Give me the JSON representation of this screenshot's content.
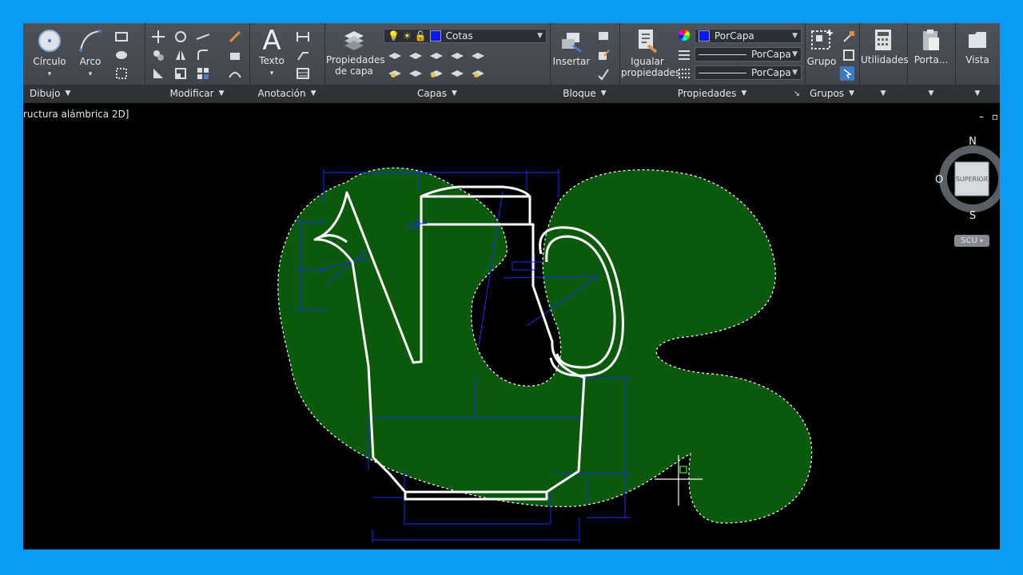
{
  "ribbon": {
    "dibujo": {
      "panel_label": "Dibujo",
      "circle": "Círculo",
      "arc": "Arco"
    },
    "modificar": {
      "panel_label": "Modificar"
    },
    "anotacion": {
      "panel_label": "Anotación",
      "text": "Texto"
    },
    "capas": {
      "panel_label": "Capas",
      "layer_props_1": "Propiedades",
      "layer_props_2": "de capa",
      "current_layer": "Cotas",
      "layer_color": "#0b16ff"
    },
    "bloque": {
      "panel_label": "Bloque",
      "insert": "Insertar"
    },
    "propiedades": {
      "panel_label": "Propiedades",
      "match_1": "Igualar",
      "match_2": "propiedades",
      "color": "PorCapa",
      "linetype": "PorCapa",
      "lineweight": "PorCapa"
    },
    "grupos": {
      "panel_label": "Grupos",
      "group": "Grupo"
    },
    "utilidades": {
      "label": "Utilidades"
    },
    "portapapeles": {
      "label": "Porta..."
    },
    "vista": {
      "label": "Vista"
    }
  },
  "viewport": {
    "label": "ructura alámbrica 2D]",
    "background": "#000000",
    "hatch_color": "#0b5a0b",
    "geometry_color": "#ffffff",
    "dimension_color": "#1a2bff"
  },
  "viewcube": {
    "north": "N",
    "south": "S",
    "west": "O",
    "face": "SUPERIOR",
    "wcs": "SCU"
  },
  "window_controls": {
    "minimize": "–",
    "restore": "▫"
  }
}
